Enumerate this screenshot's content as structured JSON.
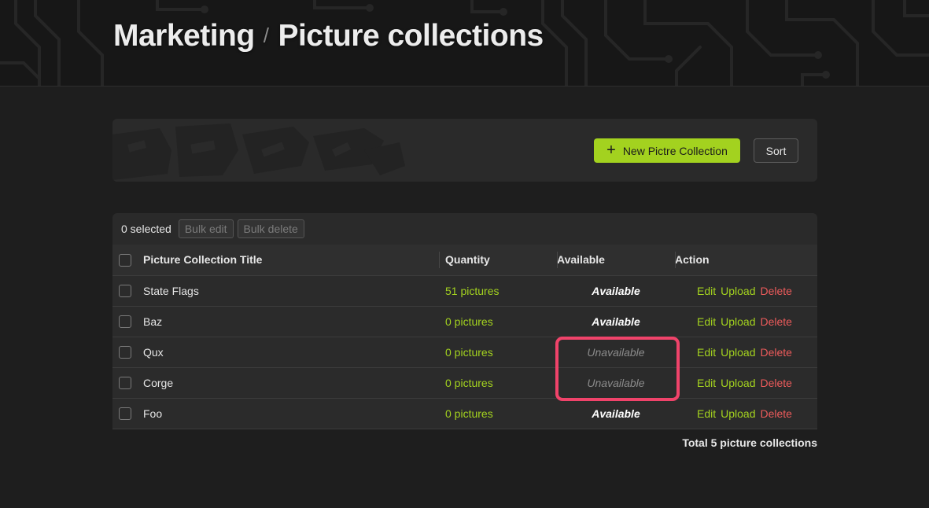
{
  "header": {
    "crumb_parent": "Marketing",
    "crumb_separator": "/",
    "crumb_current": "Picture collections"
  },
  "toolbar": {
    "new_button_icon": "plus-icon",
    "new_button_label": "New Pictre Collection",
    "sort_label": "Sort"
  },
  "bulk": {
    "selected_count": "0 selected",
    "bulk_edit_label": "Bulk edit",
    "bulk_delete_label": "Bulk delete"
  },
  "table": {
    "columns": {
      "title": "Picture Collection Title",
      "quantity": "Quantity",
      "available": "Available",
      "action": "Action"
    },
    "rows": [
      {
        "title": "State Flags",
        "quantity": "51 pictures",
        "availability": "Available",
        "available": true,
        "edit": "Edit",
        "upload": "Upload",
        "delete": "Delete"
      },
      {
        "title": "Baz",
        "quantity": "0 pictures",
        "availability": "Available",
        "available": true,
        "edit": "Edit",
        "upload": "Upload",
        "delete": "Delete"
      },
      {
        "title": "Qux",
        "quantity": "0 pictures",
        "availability": "Unavailable",
        "available": false,
        "edit": "Edit",
        "upload": "Upload",
        "delete": "Delete"
      },
      {
        "title": "Corge",
        "quantity": "0 pictures",
        "availability": "Unavailable",
        "available": false,
        "edit": "Edit",
        "upload": "Upload",
        "delete": "Delete"
      },
      {
        "title": "Foo",
        "quantity": "0 pictures",
        "availability": "Available",
        "available": true,
        "edit": "Edit",
        "upload": "Upload",
        "delete": "Delete"
      }
    ]
  },
  "footer": {
    "total": "Total 5 picture collections"
  },
  "colors": {
    "accent": "#a3d21f",
    "danger": "#ec5b5b",
    "highlight": "#f0436a",
    "background": "#1e1e1e",
    "card": "#2a2a2a"
  }
}
